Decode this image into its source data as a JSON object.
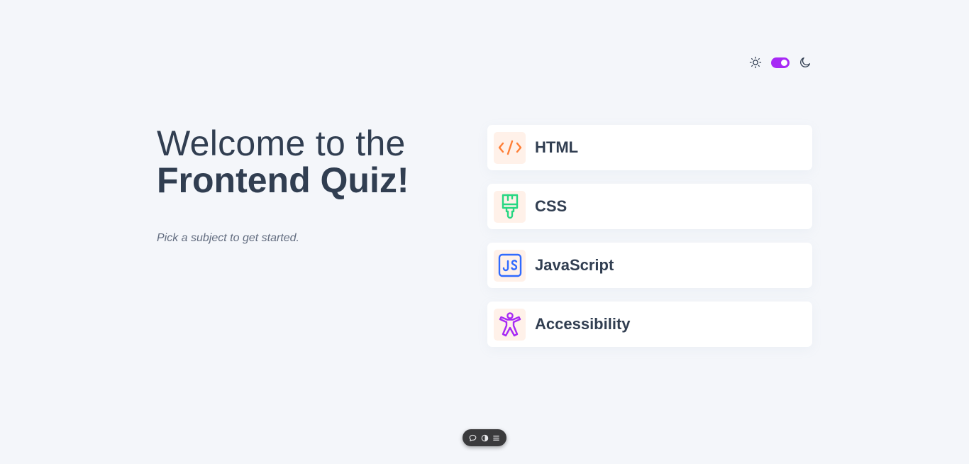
{
  "theme_toggle": {
    "light_icon": "sun-icon",
    "dark_icon": "moon-icon",
    "switch_on": true,
    "accent_color": "#a729f5"
  },
  "intro": {
    "title_line1": "Welcome to the",
    "title_line2": "Frontend Quiz!",
    "subtitle": "Pick a subject to get started."
  },
  "subjects": [
    {
      "label": "HTML",
      "icon": "html-code-icon",
      "icon_color": "#ff7e35",
      "icon_bg": "#fff1e9"
    },
    {
      "label": "CSS",
      "icon": "paintbrush-icon",
      "icon_color": "#26d782",
      "icon_bg": "#fff1e9"
    },
    {
      "label": "JavaScript",
      "icon": "javascript-icon",
      "icon_color": "#306aff",
      "icon_bg": "#fff1e9"
    },
    {
      "label": "Accessibility",
      "icon": "accessibility-icon",
      "icon_color": "#a729f5",
      "icon_bg": "#fff1e9"
    }
  ],
  "mini_toolbar": {
    "items": [
      "comment-icon",
      "contrast-icon",
      "menu-icon"
    ]
  }
}
